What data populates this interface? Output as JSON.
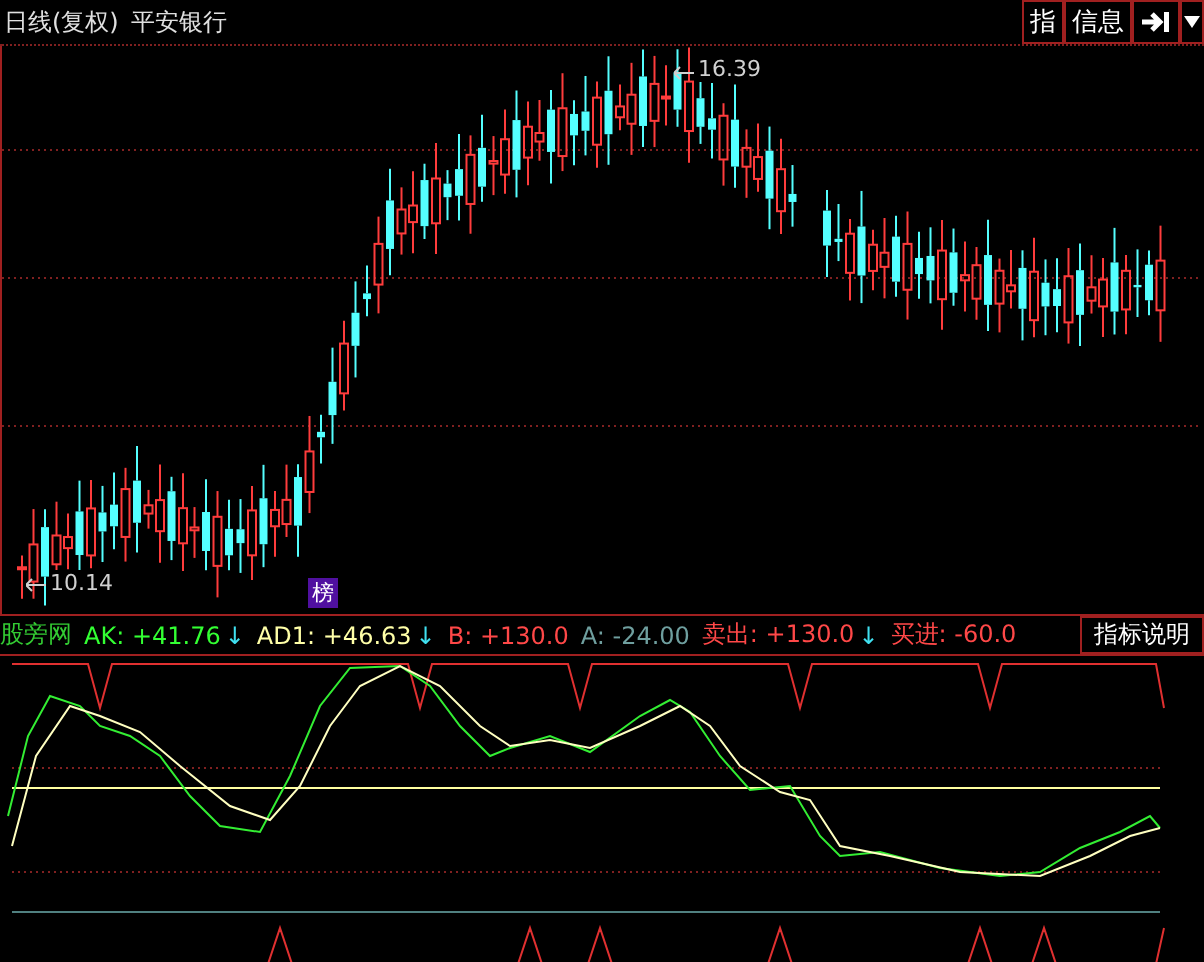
{
  "header": {
    "period": "日线(复权)",
    "stock": "平安银行",
    "buttons": [
      {
        "label": "指"
      },
      {
        "label": "信息"
      }
    ]
  },
  "price_chart": {
    "high_label": "16.39",
    "low_label": "10.14",
    "badge": "榜"
  },
  "indicator": {
    "items": [
      {
        "label": "股旁网",
        "value": "",
        "color": "#33cc33"
      },
      {
        "label": "AK:",
        "value": "+41.76",
        "color": "#33ff33",
        "arrow": "↓"
      },
      {
        "label": "AD1:",
        "value": "+46.63",
        "color": "#ffffa8",
        "arrow": "↓"
      },
      {
        "label": "B:",
        "value": "+130.0",
        "color": "#ff4848"
      },
      {
        "label": "A:",
        "value": "-24.00",
        "color": "#6f9f9f"
      },
      {
        "label": "卖出:",
        "value": "+130.0",
        "color": "#ff4848",
        "arrow": "↓"
      },
      {
        "label": "买进:",
        "value": "-60.0",
        "color": "#ff4848"
      }
    ],
    "help_button": "指标说明"
  }
}
